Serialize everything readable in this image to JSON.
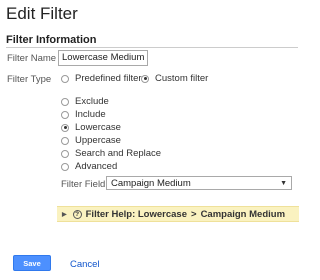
{
  "page": {
    "title": "Edit Filter"
  },
  "section": {
    "title": "Filter Information"
  },
  "filter_name": {
    "label": "Filter Name",
    "value": "Lowercase Medium"
  },
  "filter_type": {
    "label": "Filter Type",
    "options": [
      {
        "label": "Predefined filter",
        "selected": false
      },
      {
        "label": "Custom filter",
        "selected": true
      }
    ]
  },
  "custom_options": [
    {
      "label": "Exclude",
      "selected": false
    },
    {
      "label": "Include",
      "selected": false
    },
    {
      "label": "Lowercase",
      "selected": true
    },
    {
      "label": "Uppercase",
      "selected": false
    },
    {
      "label": "Search and Replace",
      "selected": false
    },
    {
      "label": "Advanced",
      "selected": false
    }
  ],
  "filter_field": {
    "label": "Filter Field",
    "value": "Campaign Medium"
  },
  "help": {
    "prefix": "Filter Help: Lowercase",
    "separator": ">",
    "topic": "Campaign Medium"
  },
  "actions": {
    "save_label": "Save",
    "cancel_label": "Cancel"
  },
  "colors": {
    "primary_button": "#4d90fe",
    "link": "#1155cc",
    "help_background": "#faf2c0"
  }
}
